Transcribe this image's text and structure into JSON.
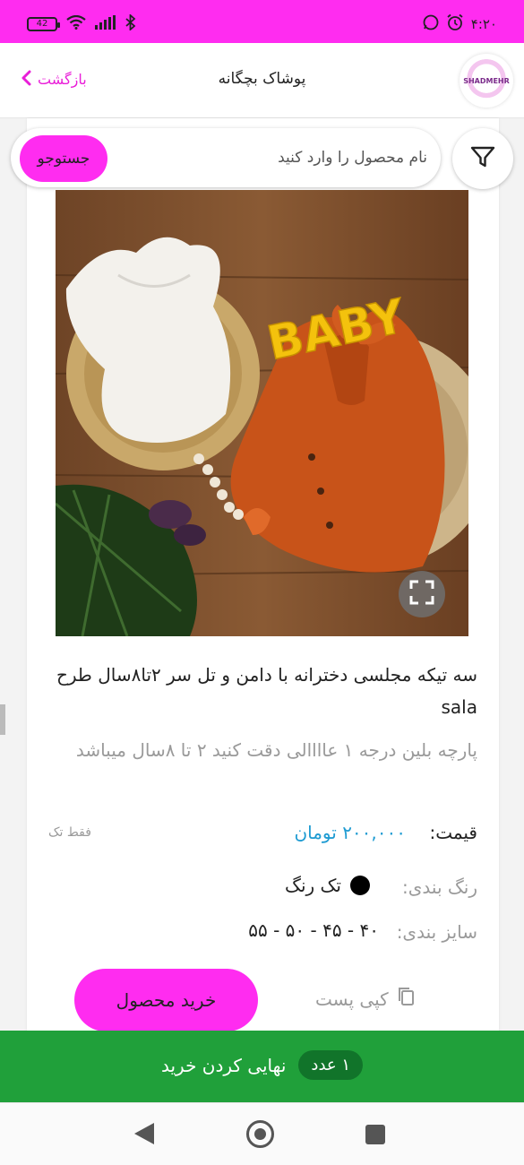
{
  "status_bar": {
    "battery": "42",
    "time": "۴:۲۰"
  },
  "header": {
    "back_label": "بازگشت",
    "title": "پوشاک بچگانه",
    "logo_text": "SHADMEHR"
  },
  "search": {
    "button_label": "جستوجو",
    "placeholder": "نام محصول را وارد کنید"
  },
  "product": {
    "title": "سه تیکه مجلسی دخترانه با دامن و تل سر ۲تا۸سال طرح sala",
    "description": "پارچه بلین درجه ۱ عاااالی دقت کنید ۲ تا ۸سال میباشد",
    "price_label": "قیمت:",
    "price_value": "۲۰۰,۰۰۰ تومان",
    "single_only": "فقط تک",
    "color_label": "رنگ بندی:",
    "color_value": "تک رنگ",
    "color_hex": "#000000",
    "size_label": "سایز بندی:",
    "size_value": "۴۰ - ۴۵ - ۵۰ - ۵۵",
    "image_text": "BABY"
  },
  "actions": {
    "buy_label": "خرید محصول",
    "copy_label": "کپی پست"
  },
  "checkout": {
    "qty": "۱ عدد",
    "label": "نهایی کردن خرید"
  },
  "colors": {
    "accent": "#ff2cf0",
    "checkout_green": "#20a03a",
    "price_blue": "#1e9bd2"
  }
}
